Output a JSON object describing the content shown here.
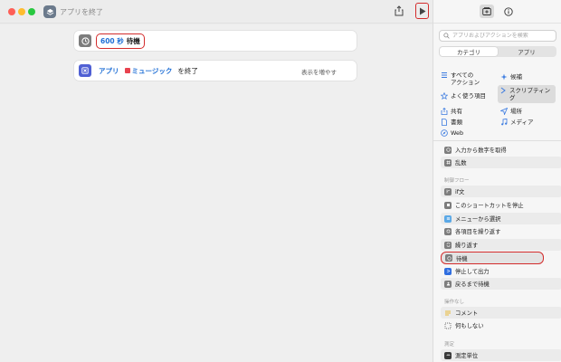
{
  "window": {
    "title": "アプリを終了"
  },
  "editor": {
    "wait_action": {
      "value": "600 秒",
      "label": "待機"
    },
    "quit_action": {
      "token_app": "アプリ",
      "token_music": "ミュージック",
      "suffix": "を終了",
      "show_more": "表示を増やす"
    }
  },
  "sidebar": {
    "search_placeholder": "アプリおよびアクションを検索",
    "segments": [
      "カテゴリ",
      "アプリ"
    ],
    "categories": {
      "all": "すべての\nアクション",
      "suggestions": "候補",
      "frequent": "よく使う項目",
      "scripting": "スクリプティング",
      "sharing": "共有",
      "location": "場所",
      "documents": "書類",
      "media": "メディア",
      "web": "Web"
    },
    "items": {
      "get_number": "入力から数字を取得",
      "random": "乱数",
      "control_flow_header": "制御フロー",
      "if": "if文",
      "stop_shortcut": "このショートカットを停止",
      "choose_menu": "メニューから選択",
      "repeat_each": "各項目を繰り返す",
      "repeat": "繰り返す",
      "wait": "待機",
      "stop_output": "停止して出力",
      "wait_return": "戻るまで待機",
      "no_action_header": "操作なし",
      "comment": "コメント",
      "nothing": "何もしない",
      "measure_header": "測定",
      "measure_unit": "測定単位"
    }
  },
  "colors": {
    "highlight_red": "#d32c2c",
    "token_blue": "#1f6fd6"
  }
}
